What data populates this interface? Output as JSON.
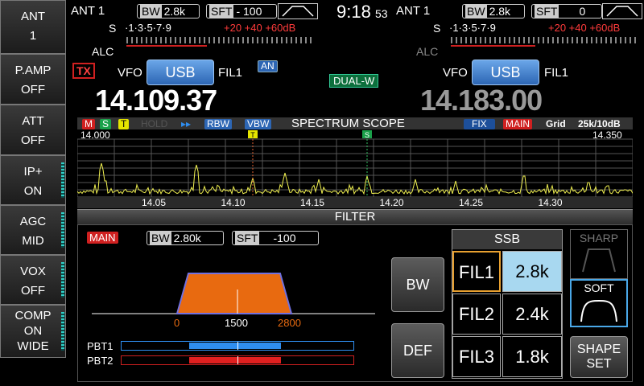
{
  "sidebar": [
    {
      "title": "ANT",
      "value": "1"
    },
    {
      "title": "P.AMP",
      "value": "OFF"
    },
    {
      "title": "ATT",
      "value": "OFF"
    },
    {
      "title": "IP+",
      "value": "ON"
    },
    {
      "title": "AGC",
      "value": "MID"
    },
    {
      "title": "VOX",
      "value": "OFF"
    },
    {
      "title": "COMP",
      "value": "ON",
      "value2": "WIDE"
    }
  ],
  "main_rx": {
    "ant": "ANT 1",
    "bw_tag": "BW",
    "bw": "2.8k",
    "sft_tag": "SFT",
    "sft": "- 100",
    "vfo": "VFO",
    "mode": "USB",
    "fil": "FIL1",
    "freq": "14.109.37"
  },
  "sub_rx": {
    "ant": "ANT 1",
    "bw_tag": "BW",
    "bw": "2.8k",
    "sft_tag": "SFT",
    "sft": "0",
    "vfo": "VFO",
    "mode": "USB",
    "fil": "FIL1",
    "freq": "14.183.00"
  },
  "clock": {
    "time": "9:18",
    "seconds": "53"
  },
  "meter": {
    "s": "S",
    "scale": "·1·3·5·7·9",
    "plus": "+20 +40 +60dB",
    "alc": "ALC"
  },
  "status": {
    "tx": "TX",
    "an": "AN",
    "dual": "DUAL-W"
  },
  "scope": {
    "title": "SPECTRUM SCOPE",
    "m": "M",
    "s": "S",
    "t": "T",
    "hold": "HOLD",
    "arrows": "▸▸",
    "rbw": "RBW",
    "vbw": "VBW",
    "fix": "FIX",
    "main": "MAIN",
    "grid": "Grid",
    "span": "25k/10dB",
    "start": "14.000",
    "end": "14.350",
    "ticks": [
      "14.05",
      "14.10",
      "14.15",
      "14.20",
      "14.25",
      "14.30"
    ],
    "marker_t": "T",
    "marker_s": "S"
  },
  "filter": {
    "title": "FILTER",
    "main": "MAIN",
    "bw_tag": "BW",
    "bw": "2.80k",
    "sft_tag": "SFT",
    "sft": "-100",
    "axis": [
      "0",
      "1500",
      "2800"
    ],
    "pbt1": "PBT1",
    "pbt2": "PBT2",
    "bw_button": "BW",
    "def_button": "DEF",
    "ssb": "SSB",
    "fils": [
      {
        "name": "FIL1",
        "value": "2.8k"
      },
      {
        "name": "FIL2",
        "value": "2.4k"
      },
      {
        "name": "FIL3",
        "value": "1.8k"
      }
    ],
    "sharp": "SHARP",
    "soft": "SOFT",
    "shape": "SHAPE",
    "set": "SET"
  },
  "colors": {
    "accent": "#2d66b4",
    "tx": "#d02020",
    "trace": "#f0f050",
    "selected": "#a8d8f0"
  }
}
